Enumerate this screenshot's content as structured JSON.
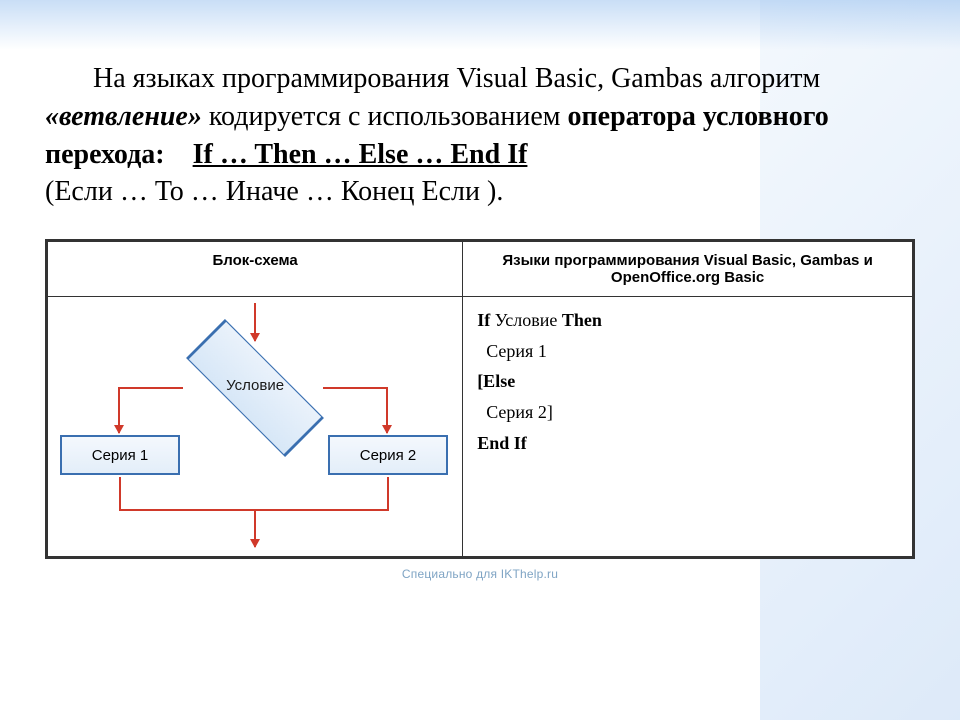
{
  "paragraph": {
    "lead_in": "На языках программирования Visual Basic, Gambas алгоритм ",
    "emphasis_term": "«ветвление»",
    "after_term": " кодируется с использованием ",
    "operator_label": "оператора условного перехода:",
    "operator_syntax": "If … Then … Else … End If",
    "translation": "(Если … То … Иначе … Конец Если )."
  },
  "table": {
    "header_left": "Блок-схема",
    "header_right": "Языки программирования Visual Basic, Gambas и OpenOffice.org Basic"
  },
  "flowchart": {
    "condition": "Условие",
    "branch_left": "Серия 1",
    "branch_right": "Серия 2"
  },
  "code": {
    "l1_kw1": "If",
    "l1_cond": "  Условие ",
    "l1_kw2": "Then",
    "l2": "  Серия 1",
    "l3_kw": "[Else",
    "l4": "  Серия 2]",
    "l5_kw1": "End",
    "l5_kw2": "  If"
  },
  "credit": "Специально для IKThelp.ru"
}
